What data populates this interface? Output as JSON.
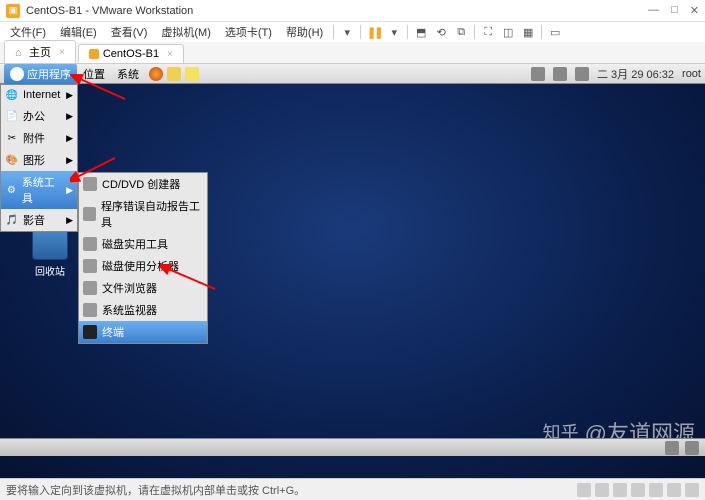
{
  "window": {
    "title": "CentOS-B1 - VMware Workstation"
  },
  "menubar": {
    "file": "文件(F)",
    "edit": "编辑(E)",
    "view": "查看(V)",
    "vm": "虚拟机(M)",
    "tabs": "选项卡(T)",
    "help": "帮助(H)"
  },
  "tabs": {
    "home": "主页",
    "vm": "CentOS-B1"
  },
  "gnome": {
    "apps": "应用程序",
    "places": "位置",
    "system": "系统",
    "date": "二  3月 29 06:32",
    "user": "root"
  },
  "appmenu": {
    "items": [
      {
        "label": "Internet"
      },
      {
        "label": "办公"
      },
      {
        "label": "附件"
      },
      {
        "label": "图形"
      },
      {
        "label": "系统工具"
      },
      {
        "label": "影音"
      }
    ]
  },
  "submenu": {
    "items": [
      {
        "label": "CD/DVD 创建器"
      },
      {
        "label": "程序错误自动报告工具"
      },
      {
        "label": "磁盘实用工具"
      },
      {
        "label": "磁盘使用分析器"
      },
      {
        "label": "文件浏览器"
      },
      {
        "label": "系统监视器"
      },
      {
        "label": "终端"
      }
    ]
  },
  "desktop": {
    "trash": "回收站"
  },
  "watermark": {
    "site": "知乎",
    "author": "@友道网源"
  },
  "statusbar": {
    "hint": "要将输入定向到该虚拟机，请在虚拟机内部单击或按 Ctrl+G。"
  }
}
